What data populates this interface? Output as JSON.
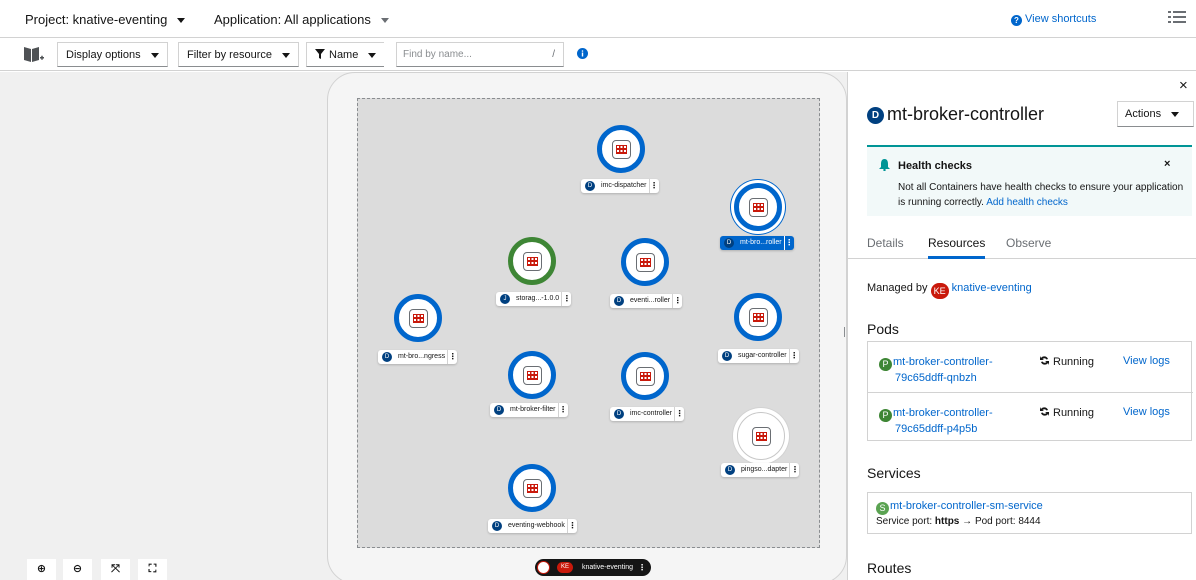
{
  "topbar": {
    "project": "Project: knative-eventing",
    "application": "Application: All applications",
    "view_shortcuts": "View shortcuts"
  },
  "toolbar": {
    "display_options": "Display options",
    "filter_by_resource": "Filter by resource",
    "name_filter": "Name",
    "search_placeholder": "Find by name...",
    "search_shortcut": "/"
  },
  "topology": {
    "nodes": [
      {
        "label": "imc-dispatcher",
        "badge": "D"
      },
      {
        "label": "mt-bro...roller",
        "badge": "D"
      },
      {
        "label": "storag...-1.0.0",
        "badge": "J"
      },
      {
        "label": "eventi...roller",
        "badge": "D"
      },
      {
        "label": "mt-bro...ngress",
        "badge": "D"
      },
      {
        "label": "sugar-controller",
        "badge": "D"
      },
      {
        "label": "mt-broker-filter",
        "badge": "D"
      },
      {
        "label": "imc-controller",
        "badge": "D"
      },
      {
        "label": "pingso...dapter",
        "badge": "D"
      },
      {
        "label": "eventing-webhook",
        "badge": "D"
      }
    ],
    "application_label": "knative-eventing",
    "application_badge": "KE",
    "kebab": "⋮"
  },
  "zoom_controls": {
    "zoom_in": "⊕",
    "zoom_out": "⊖",
    "fit": "⤧",
    "reset": "⛶"
  },
  "sidebar": {
    "close": "×",
    "title_badge": "D",
    "title": "mt-broker-controller",
    "actions": "Actions",
    "alert": {
      "title": "Health checks",
      "text": "Not all Containers have health checks to ensure your application is running correctly.",
      "link": "Add health checks",
      "close": "×"
    },
    "tabs": [
      "Details",
      "Resources",
      "Observe"
    ],
    "active_tab": "Resources",
    "managed_by_prefix": "Managed by",
    "managed_by_badge": "KE",
    "managed_by_link": "knative-eventing",
    "pods_heading": "Pods",
    "pods": [
      {
        "badge": "P",
        "name_line1": "mt-broker-controller-",
        "name_line2": "79c65ddff-qnbzh",
        "status": "Running",
        "logs": "View logs"
      },
      {
        "badge": "P",
        "name_line1": "mt-broker-controller-",
        "name_line2": "79c65ddff-p4p5b",
        "status": "Running",
        "logs": "View logs"
      }
    ],
    "services_heading": "Services",
    "service": {
      "badge": "S",
      "name": "mt-broker-controller-sm-service",
      "port_label": "Service port:",
      "service_port": "https",
      "arrow": "→",
      "pod_port_label": "Pod port:",
      "pod_port": "8444"
    },
    "routes_heading": "Routes"
  },
  "colors": {
    "link": "#0066cc",
    "deployment_badge": "#004080",
    "ring_blue": "#0066cc",
    "ring_green": "#3e8635",
    "app_badge": "#c9190b",
    "alert_accent": "#009596"
  }
}
